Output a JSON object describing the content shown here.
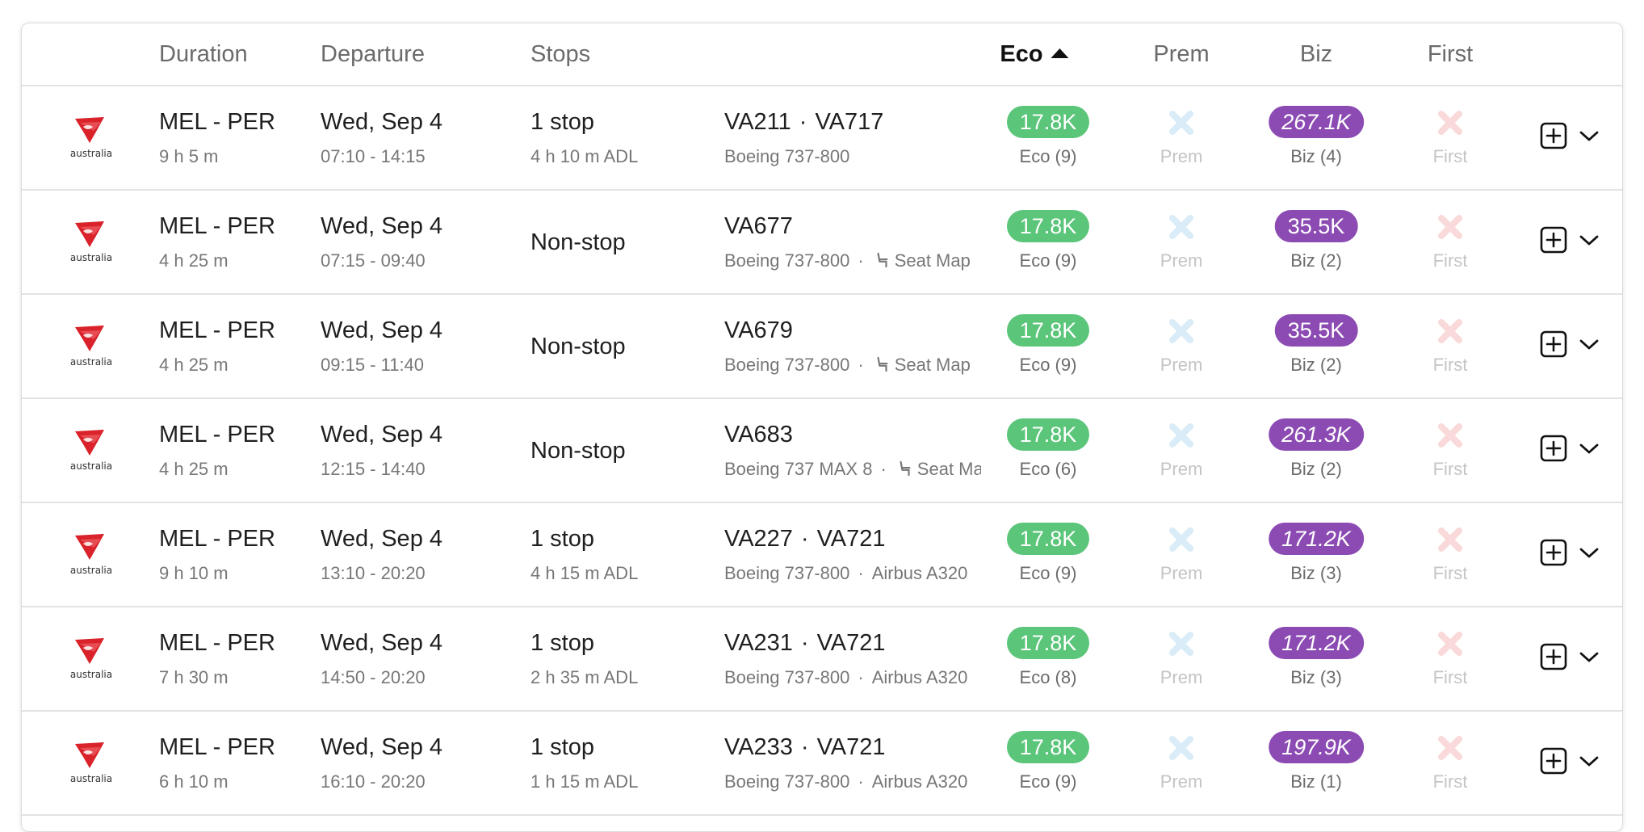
{
  "header": {
    "duration": "Duration",
    "departure": "Departure",
    "stops": "Stops",
    "eco": "Eco",
    "prem": "Prem",
    "biz": "Biz",
    "first": "First"
  },
  "airline_logo_text": "australia",
  "icons": {
    "airline": "virgin-australia-logo",
    "seat": "seat-icon",
    "unavailable": "x-icon",
    "add": "plus-square-icon",
    "expand": "chevron-down-icon",
    "sort": "sort-ascending-icon"
  },
  "colors": {
    "eco_pill": "#5bc57a",
    "biz_pill": "#8c4bb3",
    "prem_unavailable": "#d9ecf7",
    "first_unavailable": "#f9d9d9"
  },
  "seat_map_label": "Seat Map",
  "flights": [
    {
      "route": "MEL - PER",
      "duration": "9 h 5 m",
      "date": "Wed, Sep 4",
      "times": "07:10 - 14:15",
      "stops": "1 stop",
      "layover": "4 h 10 m  ADL",
      "flight1": "VA211",
      "flight2": "VA717",
      "aircraft1": "Boeing 737-800",
      "aircraft2": "",
      "eco_price": "17.8K",
      "eco_seats": "Eco (9)",
      "prem_label": "Prem",
      "biz_price": "267.1K",
      "biz_seats": "Biz (4)",
      "biz_italic": true,
      "first_label": "First"
    },
    {
      "route": "MEL - PER",
      "duration": "4 h 25 m",
      "date": "Wed, Sep 4",
      "times": "07:15 - 09:40",
      "stops": "Non-stop",
      "layover": "",
      "flight1": "VA677",
      "flight2": "",
      "aircraft1": "Boeing 737-800",
      "aircraft2": "Seat Map",
      "eco_price": "17.8K",
      "eco_seats": "Eco (9)",
      "prem_label": "Prem",
      "biz_price": "35.5K",
      "biz_seats": "Biz (2)",
      "biz_italic": false,
      "first_label": "First"
    },
    {
      "route": "MEL - PER",
      "duration": "4 h 25 m",
      "date": "Wed, Sep 4",
      "times": "09:15 - 11:40",
      "stops": "Non-stop",
      "layover": "",
      "flight1": "VA679",
      "flight2": "",
      "aircraft1": "Boeing 737-800",
      "aircraft2": "Seat Map",
      "eco_price": "17.8K",
      "eco_seats": "Eco (9)",
      "prem_label": "Prem",
      "biz_price": "35.5K",
      "biz_seats": "Biz (2)",
      "biz_italic": false,
      "first_label": "First"
    },
    {
      "route": "MEL - PER",
      "duration": "4 h 25 m",
      "date": "Wed, Sep 4",
      "times": "12:15 - 14:40",
      "stops": "Non-stop",
      "layover": "",
      "flight1": "VA683",
      "flight2": "",
      "aircraft1": "Boeing 737 MAX 8",
      "aircraft2": "Seat Map",
      "eco_price": "17.8K",
      "eco_seats": "Eco (6)",
      "prem_label": "Prem",
      "biz_price": "261.3K",
      "biz_seats": "Biz (2)",
      "biz_italic": true,
      "first_label": "First"
    },
    {
      "route": "MEL - PER",
      "duration": "9 h 10 m",
      "date": "Wed, Sep 4",
      "times": "13:10 - 20:20",
      "stops": "1 stop",
      "layover": "4 h 15 m  ADL",
      "flight1": "VA227",
      "flight2": "VA721",
      "aircraft1": "Boeing 737-800",
      "aircraft2": "Airbus A320",
      "eco_price": "17.8K",
      "eco_seats": "Eco (9)",
      "prem_label": "Prem",
      "biz_price": "171.2K",
      "biz_seats": "Biz (3)",
      "biz_italic": true,
      "first_label": "First"
    },
    {
      "route": "MEL - PER",
      "duration": "7 h 30 m",
      "date": "Wed, Sep 4",
      "times": "14:50 - 20:20",
      "stops": "1 stop",
      "layover": "2 h 35 m  ADL",
      "flight1": "VA231",
      "flight2": "VA721",
      "aircraft1": "Boeing 737-800",
      "aircraft2": "Airbus A320",
      "eco_price": "17.8K",
      "eco_seats": "Eco (8)",
      "prem_label": "Prem",
      "biz_price": "171.2K",
      "biz_seats": "Biz (3)",
      "biz_italic": true,
      "first_label": "First"
    },
    {
      "route": "MEL - PER",
      "duration": "6 h 10 m",
      "date": "Wed, Sep 4",
      "times": "16:10 - 20:20",
      "stops": "1 stop",
      "layover": "1 h 15 m  ADL",
      "flight1": "VA233",
      "flight2": "VA721",
      "aircraft1": "Boeing 737-800",
      "aircraft2": "Airbus A320",
      "eco_price": "17.8K",
      "eco_seats": "Eco (9)",
      "prem_label": "Prem",
      "biz_price": "197.9K",
      "biz_seats": "Biz (1)",
      "biz_italic": true,
      "first_label": "First"
    }
  ]
}
